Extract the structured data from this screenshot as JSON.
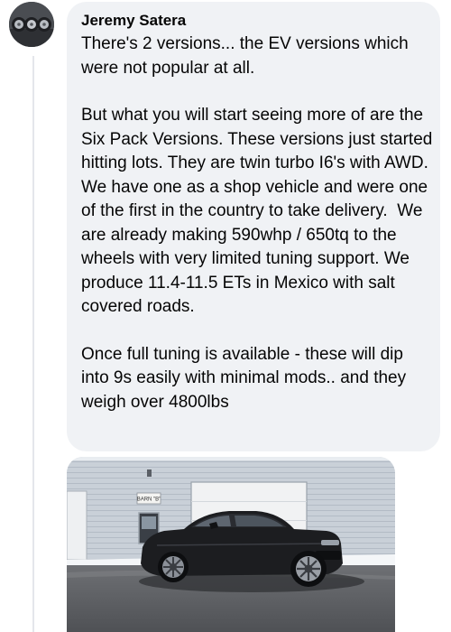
{
  "comment": {
    "author": "Jeremy Satera",
    "paragraphs": [
      "There's 2 versions... the EV versions which were not popular at all.",
      "But what you will start seeing more of are the Six Pack Versions. These versions just started hitting lots. They are twin turbo I6's with AWD. We have one as a shop vehicle and were one of the first in the country to take delivery.  We are already making 590whp / 650tq to the wheels with very limited tuning support. We produce 11.4-11.5 ETs in Mexico with salt covered roads.",
      "Once full tuning is available - these will dip into 9s easily with minimal mods.. and they weigh over 4800lbs"
    ]
  },
  "avatar": {
    "icon": "avatar-wheels-icon"
  },
  "photo": {
    "sign_text": "BARN \"B\"",
    "car_color": "#1c1d20",
    "building_color": "#c9d0d8"
  }
}
